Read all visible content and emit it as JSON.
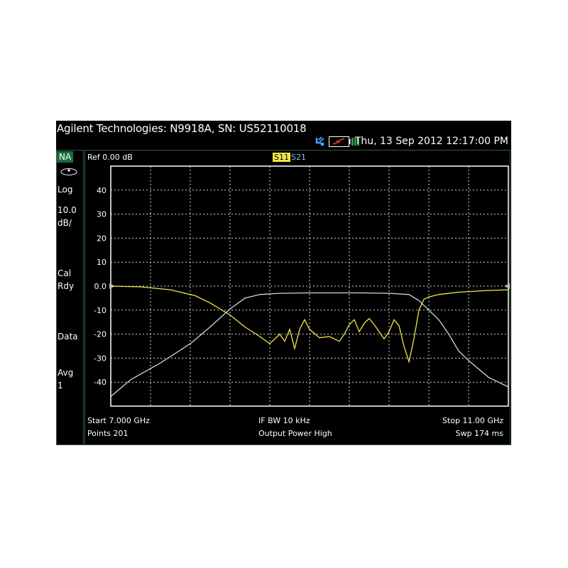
{
  "instrument": {
    "title": "Agilent Technologies: N9918A, SN: US52110018",
    "datetime": "Thu, 13 Sep 2012 12:17:00 PM"
  },
  "left_panel": {
    "mode": "NA",
    "scale_type": "Log",
    "scale_value": "10.0",
    "scale_unit": "dB/",
    "cal_line1": "Cal",
    "cal_line2": "Rdy",
    "data_label": "Data",
    "avg_label": "Avg",
    "avg_value": "1"
  },
  "plot_header": {
    "ref": "Ref 0.00 dB",
    "trace1": "S11",
    "trace2": "S21"
  },
  "footer": {
    "start": "Start 7.000 GHz",
    "points": "Points 201",
    "ifbw": "IF BW 10 kHz",
    "power": "Output Power High",
    "stop": "Stop 11.00 GHz",
    "sweep": "Swp 174 ms"
  },
  "colors": {
    "s11": "#f4e54a",
    "s21": "#c8d8ee",
    "grid": "#d8d8d8",
    "frame": "#ffffff",
    "panel_border": "#2f5a3a",
    "mode_badge": "#1b6d3c"
  },
  "chart_data": {
    "type": "line",
    "xlabel": "",
    "ylabel": "",
    "xlim": [
      7.0,
      11.0
    ],
    "ylim": [
      -50,
      50
    ],
    "y_ticks": [
      40,
      30,
      20,
      10,
      0.0,
      -10,
      -20,
      -30,
      -40
    ],
    "y_tick_labels": [
      "40",
      "30",
      "20",
      "10",
      "0.0",
      "-10",
      "-20",
      "-30",
      "-40"
    ],
    "grid": true,
    "series": [
      {
        "name": "S11",
        "x": [
          7.0,
          7.3,
          7.6,
          7.85,
          8.0,
          8.2,
          8.35,
          8.5,
          8.6,
          8.7,
          8.75,
          8.8,
          8.85,
          8.9,
          8.95,
          9.0,
          9.1,
          9.2,
          9.3,
          9.35,
          9.4,
          9.45,
          9.5,
          9.55,
          9.6,
          9.65,
          9.7,
          9.75,
          9.8,
          9.85,
          9.9,
          9.95,
          10.0,
          10.05,
          10.1,
          10.15,
          10.2,
          10.3,
          10.5,
          10.8,
          11.0
        ],
        "y": [
          0,
          -0.3,
          -1.5,
          -4,
          -7,
          -12,
          -17,
          -21,
          -24,
          -20,
          -23,
          -18,
          -26,
          -18,
          -14,
          -18,
          -21.5,
          -21,
          -23,
          -20,
          -16,
          -14,
          -19,
          -15.5,
          -13.5,
          -16,
          -19,
          -22,
          -19,
          -14,
          -16.5,
          -25,
          -31.5,
          -22,
          -10,
          -5.5,
          -4.5,
          -3.5,
          -2.5,
          -1.8,
          -1.5
        ]
      },
      {
        "name": "S21",
        "x": [
          7.0,
          7.2,
          7.5,
          7.8,
          8.0,
          8.2,
          8.35,
          8.5,
          8.7,
          9.0,
          9.5,
          9.8,
          10.0,
          10.1,
          10.2,
          10.3,
          10.4,
          10.5,
          10.6,
          10.8,
          11.0
        ],
        "y": [
          -46,
          -39,
          -32,
          -24,
          -17,
          -9.5,
          -5,
          -3.5,
          -3,
          -2.8,
          -2.8,
          -3,
          -3.5,
          -6,
          -10,
          -14,
          -20,
          -27,
          -31,
          -38,
          -42
        ]
      }
    ]
  }
}
